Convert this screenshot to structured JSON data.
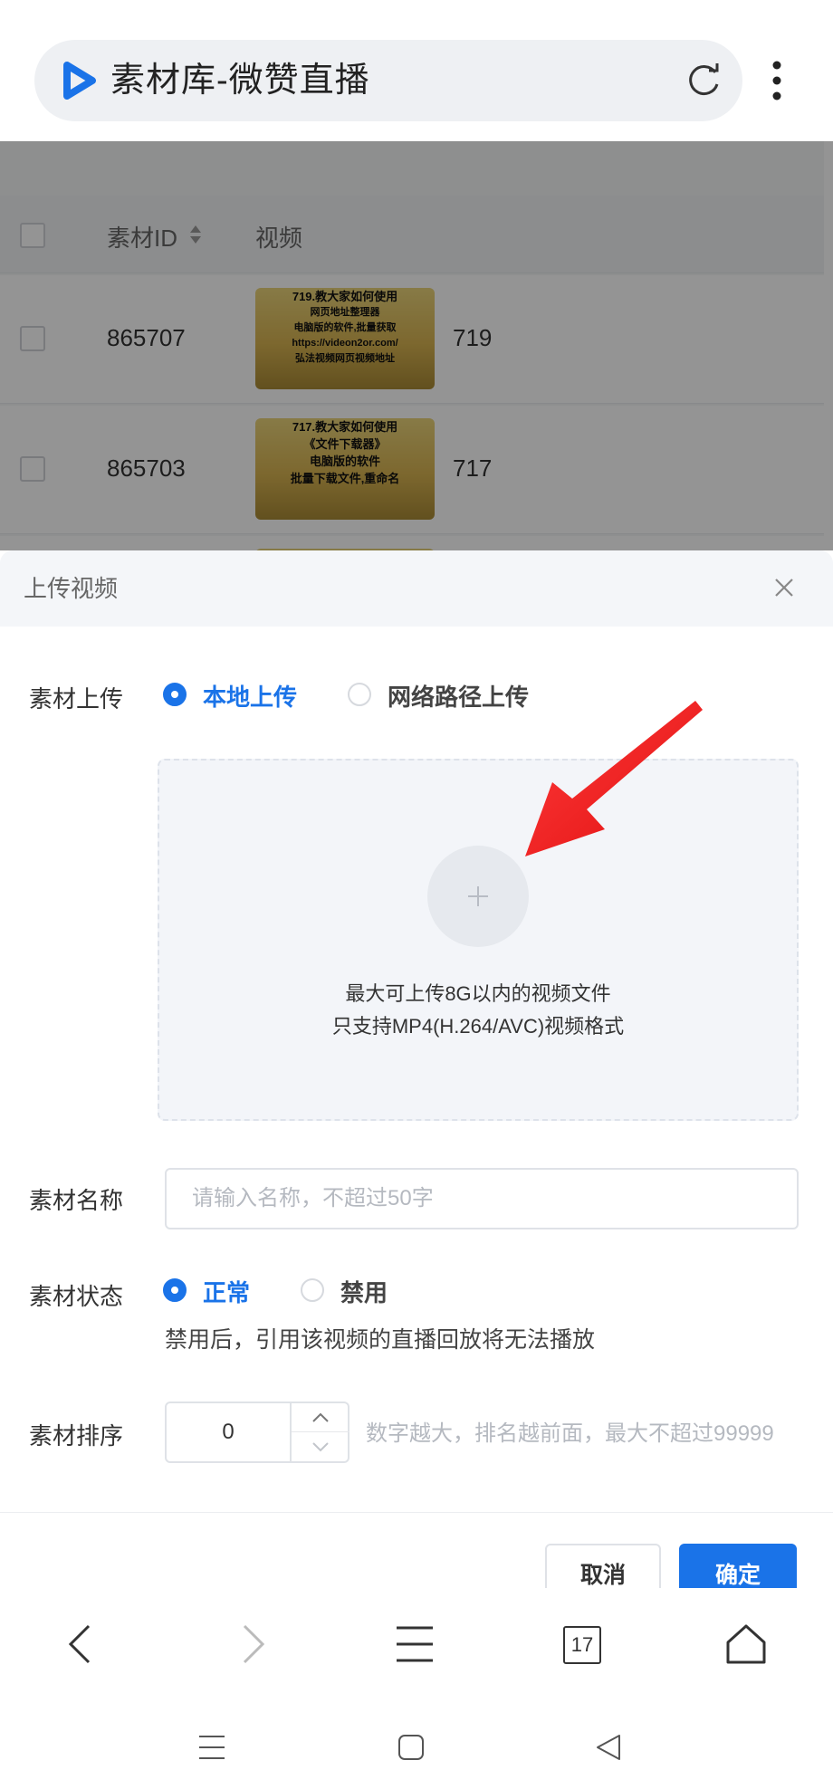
{
  "browser": {
    "title": "素材库-微赞直播",
    "tab_count": "17"
  },
  "table": {
    "header": {
      "id_label": "素材ID",
      "video_label": "视频"
    },
    "rows": [
      {
        "id": "865707",
        "num": "719",
        "thumb_lines": [
          "719.教大家如何使用",
          "网页地址整理器",
          "电脑版的软件,批量获取",
          "https://videon2or.com/",
          "弘法视频网页视频地址"
        ]
      },
      {
        "id": "865703",
        "num": "717",
        "thumb_lines": [
          "717.教大家如何使用",
          "《文件下载器》",
          "电脑版的软件",
          "批量下载文件,重命名"
        ]
      }
    ]
  },
  "dialog": {
    "title": "上传视频",
    "upload": {
      "label": "素材上传",
      "option_local": "本地上传",
      "option_network": "网络路径上传",
      "selected": "本地上传",
      "hint_line1": "最大可上传8G以内的视频文件",
      "hint_line2": "只支持MP4(H.264/AVC)视频格式"
    },
    "name": {
      "label": "素材名称",
      "placeholder": "请输入名称，不超过50字",
      "value": ""
    },
    "status": {
      "label": "素材状态",
      "option_normal": "正常",
      "option_disabled": "禁用",
      "selected": "正常",
      "note": "禁用后，引用该视频的直播回放将无法播放"
    },
    "sort": {
      "label": "素材排序",
      "value": "0",
      "hint": "数字越大，排名越前面，最大不超过99999"
    },
    "buttons": {
      "cancel": "取消",
      "confirm": "确定"
    }
  },
  "colors": {
    "accent": "#1a73e8",
    "annotation_arrow": "#ee1c1c"
  }
}
